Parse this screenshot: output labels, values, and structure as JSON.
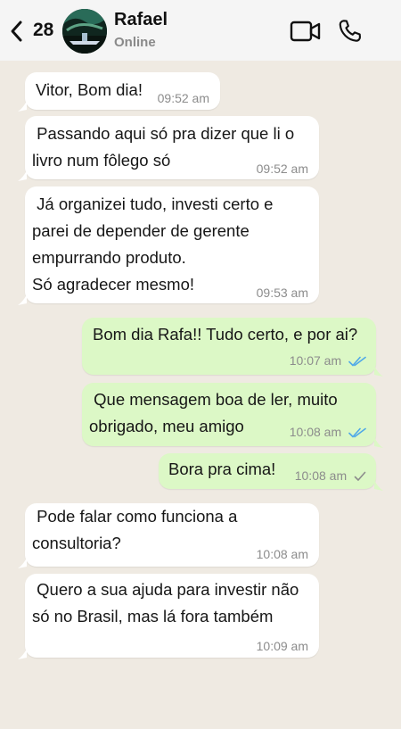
{
  "header": {
    "back_icon": "chevron-left-icon",
    "unread_count": "28",
    "contact_name": "Rafael",
    "status": "Online",
    "video_icon": "video-camera-icon",
    "call_icon": "phone-icon"
  },
  "colors": {
    "header_bg": "#f5f5f5",
    "chat_bg": "#efeae2",
    "incoming_bubble": "#ffffff",
    "outgoing_bubble": "#dcf8c6",
    "read_tick": "#4fa8e8",
    "sent_tick": "#8c8c8c",
    "timestamp": "#8c8c8c"
  },
  "messages": [
    {
      "direction": "incoming",
      "text": "Vitor, Bom dia!",
      "time": "09:52 am"
    },
    {
      "direction": "incoming",
      "text": " Passando aqui só pra dizer que li o\nlivro num fôlego só",
      "time": "09:52 am"
    },
    {
      "direction": "incoming",
      "text": " Já organizei tudo, investi certo e\nparei de depender de gerente\nempurrando produto.\nSó agradecer mesmo!",
      "time": "09:53 am"
    },
    {
      "direction": "outgoing",
      "text": "Bom dia Rafa!! Tudo certo, e por ai?",
      "time": "10:07 am",
      "status": "read",
      "status_icon": "double-check-icon"
    },
    {
      "direction": "outgoing",
      "text": " Que mensagem boa de ler, muito\nobrigado, meu amigo",
      "time": "10:08 am",
      "status": "read",
      "status_icon": "double-check-icon"
    },
    {
      "direction": "outgoing",
      "text": "Bora pra cima!",
      "time": "10:08 am",
      "status": "sent",
      "status_icon": "single-check-icon"
    },
    {
      "direction": "incoming",
      "text": " Pode falar como funciona a\nconsultoria?",
      "time": "10:08 am"
    },
    {
      "direction": "incoming",
      "text": " Quero a sua ajuda para investir não\nsó no Brasil, mas lá fora também",
      "time": "10:09 am"
    }
  ]
}
